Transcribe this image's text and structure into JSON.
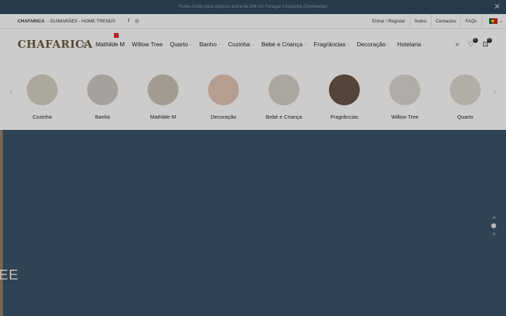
{
  "promo": {
    "text": "Portes Grátis para compras acima de 50€ em Portugal e Espanha (Continental)",
    "close": "✕"
  },
  "topbar": {
    "brand": "CHAFARICA",
    "tagline": "- GUIMARÃES - HOME TRENDS",
    "socials": [
      "f",
      "◎"
    ],
    "links": [
      "Entrar / Registar",
      "Sobre",
      "Contactos",
      "FAQs"
    ],
    "language": "PT"
  },
  "header": {
    "logo": "CHAFARICA",
    "nav": [
      {
        "label": "Mathilde M",
        "has_badge": true,
        "has_chevron": false
      },
      {
        "label": "Willow Tree",
        "has_badge": false,
        "has_chevron": false
      },
      {
        "label": "Quarto",
        "has_badge": false,
        "has_chevron": true
      },
      {
        "label": "Banho",
        "has_badge": false,
        "has_chevron": true
      },
      {
        "label": "Cozinha",
        "has_badge": false,
        "has_chevron": true
      },
      {
        "label": "Bebé e Criança",
        "has_badge": false,
        "has_chevron": true
      },
      {
        "label": "Fragrâncias",
        "has_badge": false,
        "has_chevron": true
      },
      {
        "label": "Decoração",
        "has_badge": false,
        "has_chevron": true
      },
      {
        "label": "Hotelaria",
        "has_badge": false,
        "has_chevron": true
      }
    ],
    "wishlist_count": "0",
    "cart_count": "0"
  },
  "categories": [
    {
      "label": "Cozinha",
      "color": "#d8d2c6"
    },
    {
      "label": "Banho",
      "color": "#cfcac3"
    },
    {
      "label": "Mathilde M",
      "color": "#cbc4b5"
    },
    {
      "label": "Decoração",
      "color": "#e3c6b4"
    },
    {
      "label": "Bebé e Criança",
      "color": "#d6d0c8"
    },
    {
      "label": "Fragrâncias",
      "color": "#6b5547"
    },
    {
      "label": "Willow Tree",
      "color": "#dcd9d2"
    },
    {
      "label": "Quarto",
      "color": "#dedad2"
    }
  ],
  "hero": {
    "text": "EE",
    "slides": 3,
    "active_slide": 2
  },
  "colors": {
    "promo_bg": "#34495e",
    "hero_bg": "#3d5469",
    "logo": "#6a5a3a"
  }
}
